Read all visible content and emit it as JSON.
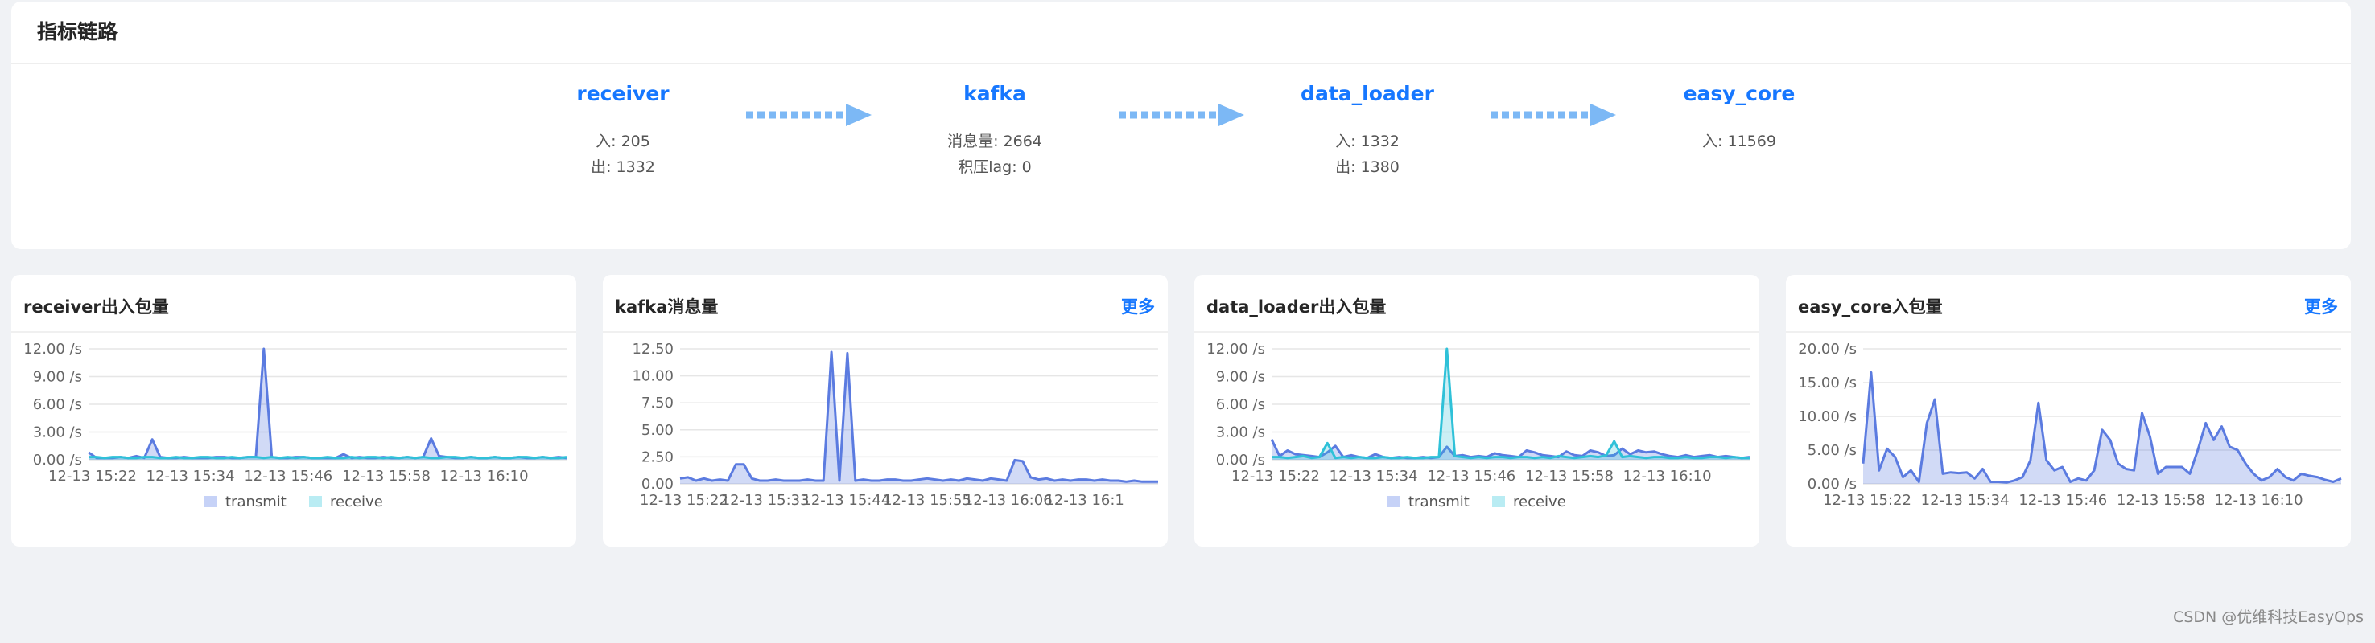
{
  "link_panel": {
    "title": "指标链路",
    "nodes": [
      {
        "name": "receiver",
        "lines": [
          "入: 205",
          "出: 1332"
        ]
      },
      {
        "name": "kafka",
        "lines": [
          "消息量: 2664",
          "积压lag: 0"
        ]
      },
      {
        "name": "data_loader",
        "lines": [
          "入: 1332",
          "出: 1380"
        ]
      },
      {
        "name": "easy_core",
        "lines": [
          "入: 11569"
        ]
      }
    ]
  },
  "cards": [
    {
      "title": "receiver出入包量",
      "more": ""
    },
    {
      "title": "kafka消息量",
      "more": "更多"
    },
    {
      "title": "data_loader出入包量",
      "more": ""
    },
    {
      "title": "easy_core入包量",
      "more": "更多"
    }
  ],
  "colors": {
    "accent": "#1677ff",
    "arrow": "#7cb8f5",
    "transmit": "#5b7be0",
    "receive": "#2fc1d8",
    "area": "#cfd8f6"
  },
  "watermark": "CSDN @优维科技EasyOps",
  "chart_data": [
    {
      "type": "area",
      "ylim": [
        0,
        12
      ],
      "yticks": [
        "12.00 /s",
        "9.00 /s",
        "6.00 /s",
        "3.00 /s",
        "0.00 /s"
      ],
      "xticks": [
        "12-13 15:22",
        "12-13 15:34",
        "12-13 15:46",
        "12-13 15:58",
        "12-13 16:10"
      ],
      "legend": [
        "transmit",
        "receive"
      ],
      "series": [
        {
          "name": "transmit",
          "values": [
            0.8,
            0.2,
            0.2,
            0.2,
            0.3,
            0.2,
            0.4,
            0.2,
            2.2,
            0.3,
            0.2,
            0.2,
            0.3,
            0.2,
            0.2,
            0.2,
            0.3,
            0.3,
            0.2,
            0.2,
            0.3,
            0.3,
            12.0,
            0.3,
            0.2,
            0.2,
            0.3,
            0.3,
            0.2,
            0.2,
            0.2,
            0.2,
            0.6,
            0.2,
            0.3,
            0.2,
            0.2,
            0.3,
            0.2,
            0.2,
            0.3,
            0.2,
            0.3,
            2.3,
            0.4,
            0.3,
            0.2,
            0.2,
            0.3,
            0.2,
            0.2,
            0.3,
            0.2,
            0.2,
            0.3,
            0.2,
            0.2,
            0.3,
            0.2,
            0.3,
            0.2
          ]
        },
        {
          "name": "receive",
          "values": [
            0.3,
            0.3,
            0.2,
            0.3,
            0.3,
            0.2,
            0.2,
            0.3,
            0.3,
            0.2,
            0.2,
            0.3,
            0.2,
            0.2,
            0.3,
            0.3,
            0.2,
            0.2,
            0.3,
            0.2,
            0.3,
            0.3,
            0.2,
            0.3,
            0.2,
            0.3,
            0.2,
            0.3,
            0.2,
            0.2,
            0.3,
            0.2,
            0.2,
            0.3,
            0.2,
            0.3,
            0.3,
            0.2,
            0.3,
            0.2,
            0.3,
            0.2,
            0.3,
            0.2,
            0.2,
            0.3,
            0.3,
            0.2,
            0.3,
            0.2,
            0.2,
            0.3,
            0.2,
            0.2,
            0.3,
            0.3,
            0.2,
            0.3,
            0.2,
            0.2,
            0.3
          ]
        }
      ]
    },
    {
      "type": "area",
      "ylim": [
        0,
        12.5
      ],
      "yticks": [
        "12.50",
        "10.00",
        "7.50",
        "5.00",
        "2.50",
        "0.00"
      ],
      "xticks": [
        "12-13 15:22",
        "12-13 15:33",
        "12-13 15:44",
        "12-13 15:55",
        "12-13 16:06",
        "12-13 16:1"
      ],
      "legend": [],
      "series": [
        {
          "name": "",
          "values": [
            0.5,
            0.6,
            0.3,
            0.5,
            0.3,
            0.4,
            0.3,
            1.8,
            1.8,
            0.5,
            0.3,
            0.3,
            0.4,
            0.3,
            0.3,
            0.3,
            0.4,
            0.3,
            0.3,
            12.2,
            0.3,
            12.1,
            0.3,
            0.4,
            0.3,
            0.3,
            0.4,
            0.4,
            0.3,
            0.3,
            0.4,
            0.5,
            0.4,
            0.3,
            0.4,
            0.3,
            0.5,
            0.4,
            0.3,
            0.5,
            0.4,
            0.3,
            2.2,
            2.1,
            0.6,
            0.4,
            0.5,
            0.3,
            0.4,
            0.3,
            0.4,
            0.4,
            0.3,
            0.4,
            0.3,
            0.3,
            0.2,
            0.3,
            0.2,
            0.2,
            0.2
          ]
        }
      ]
    },
    {
      "type": "area",
      "ylim": [
        0,
        12
      ],
      "yticks": [
        "12.00 /s",
        "9.00 /s",
        "6.00 /s",
        "3.00 /s",
        "0.00 /s"
      ],
      "xticks": [
        "12-13 15:22",
        "12-13 15:34",
        "12-13 15:46",
        "12-13 15:58",
        "12-13 16:10"
      ],
      "legend": [
        "transmit",
        "receive"
      ],
      "series": [
        {
          "name": "transmit",
          "values": [
            2.2,
            0.4,
            1.0,
            0.6,
            0.5,
            0.4,
            0.3,
            0.8,
            1.5,
            0.3,
            0.5,
            0.3,
            0.2,
            0.6,
            0.3,
            0.2,
            0.3,
            0.2,
            0.2,
            0.3,
            0.2,
            0.3,
            1.4,
            0.4,
            0.5,
            0.3,
            0.4,
            0.3,
            0.7,
            0.5,
            0.4,
            0.3,
            1.0,
            0.8,
            0.5,
            0.4,
            0.3,
            0.9,
            0.5,
            0.4,
            1.0,
            0.8,
            0.4,
            0.5,
            1.2,
            0.6,
            1.0,
            0.8,
            0.9,
            0.6,
            0.4,
            0.3,
            0.5,
            0.3,
            0.4,
            0.5,
            0.3,
            0.4,
            0.3,
            0.2,
            0.3
          ]
        },
        {
          "name": "receive",
          "values": [
            0.3,
            0.3,
            0.2,
            0.3,
            0.4,
            0.2,
            0.3,
            1.8,
            0.2,
            0.3,
            0.2,
            0.3,
            0.2,
            0.2,
            0.3,
            0.2,
            0.2,
            0.3,
            0.2,
            0.2,
            0.3,
            0.3,
            12.0,
            0.4,
            0.3,
            0.2,
            0.3,
            0.2,
            0.3,
            0.3,
            0.2,
            0.3,
            0.3,
            0.2,
            0.3,
            0.2,
            0.4,
            0.3,
            0.2,
            0.3,
            0.4,
            0.3,
            0.5,
            2.0,
            0.3,
            0.4,
            0.3,
            0.2,
            0.3,
            0.3,
            0.2,
            0.2,
            0.3,
            0.2,
            0.2,
            0.3,
            0.3,
            0.2,
            0.3,
            0.2,
            0.2
          ]
        }
      ]
    },
    {
      "type": "area",
      "ylim": [
        0,
        20
      ],
      "yticks": [
        "20.00 /s",
        "15.00 /s",
        "10.00 /s",
        "5.00 /s",
        "0.00 /s"
      ],
      "xticks": [
        "12-13 15:22",
        "12-13 15:34",
        "12-13 15:46",
        "12-13 15:58",
        "12-13 16:10"
      ],
      "legend": [],
      "series": [
        {
          "name": "",
          "values": [
            3.0,
            16.5,
            2.0,
            5.2,
            4.0,
            1.0,
            2.0,
            0.3,
            9.0,
            12.5,
            1.5,
            1.7,
            1.6,
            1.7,
            0.8,
            2.2,
            0.3,
            0.3,
            0.2,
            0.5,
            1.0,
            3.5,
            12.0,
            3.5,
            2.0,
            2.5,
            0.3,
            0.8,
            0.5,
            2.0,
            8.0,
            6.5,
            3.0,
            2.2,
            2.0,
            10.5,
            7.0,
            1.5,
            2.5,
            2.5,
            2.5,
            1.5,
            5.0,
            9.0,
            6.5,
            8.5,
            5.5,
            5.0,
            3.0,
            1.5,
            0.5,
            1.0,
            2.2,
            1.0,
            0.5,
            1.5,
            1.2,
            1.0,
            0.6,
            0.3,
            0.8
          ]
        }
      ]
    }
  ]
}
